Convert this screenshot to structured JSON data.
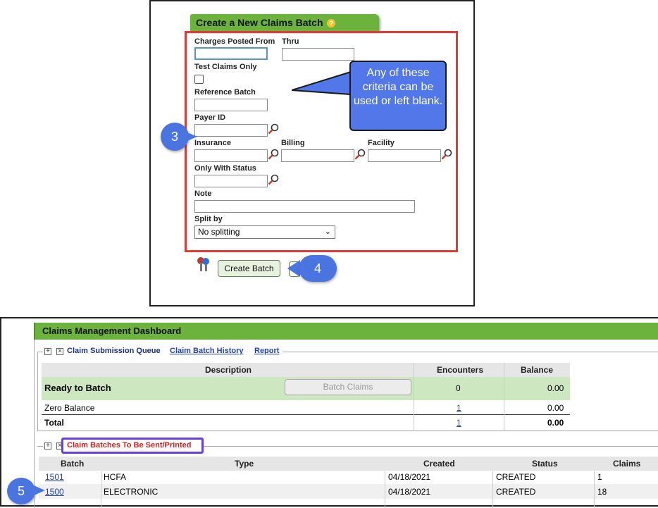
{
  "create_batch": {
    "title": "Create a New Claims Batch",
    "help_icon": "help-icon",
    "fields": {
      "charges_posted_from": {
        "label": "Charges Posted From",
        "value": ""
      },
      "thru": {
        "label": "Thru",
        "value": ""
      },
      "test_claims_only": {
        "label": "Test Claims Only",
        "checked": false
      },
      "reference_batch": {
        "label": "Reference Batch",
        "value": ""
      },
      "payer_id": {
        "label": "Payer ID",
        "value": ""
      },
      "insurance": {
        "label": "Insurance",
        "value": ""
      },
      "billing": {
        "label": "Billing",
        "value": ""
      },
      "facility": {
        "label": "Facility",
        "value": ""
      },
      "only_with_status": {
        "label": "Only With Status",
        "value": ""
      },
      "note": {
        "label": "Note",
        "value": ""
      },
      "split_by": {
        "label": "Split by",
        "selected": "No splitting"
      }
    },
    "create_button": "Create Batch",
    "callout_text": "Any of these criteria can be used or left blank.",
    "step_badges": {
      "payer": "3",
      "create": "4"
    }
  },
  "dashboard": {
    "title": "Claims Management Dashboard",
    "queue": {
      "title": "Claim Submission Queue",
      "links": {
        "history": "Claim Batch History",
        "report": "Report"
      },
      "headers": {
        "description": "Description",
        "encounters": "Encounters",
        "balance": "Balance"
      },
      "batch_claims_button": "Batch Claims",
      "rows": [
        {
          "description": "Ready to Batch",
          "encounters": "0",
          "balance": "0.00"
        },
        {
          "description": "Zero Balance",
          "encounters": "1",
          "balance": "0.00"
        },
        {
          "description": "Total",
          "encounters": "1",
          "balance": "0.00"
        }
      ]
    },
    "batches": {
      "title": "Claim Batches To Be Sent/Printed",
      "headers": {
        "batch": "Batch",
        "type": "Type",
        "created": "Created",
        "status": "Status",
        "claims": "Claims"
      },
      "rows": [
        {
          "batch": "1501",
          "type": "HCFA",
          "created": "04/18/2021",
          "status": "CREATED",
          "claims": "1"
        },
        {
          "batch": "1500",
          "type": "ELECTRONIC",
          "created": "04/18/2021",
          "status": "CREATED",
          "claims": "18"
        }
      ]
    },
    "step_badge": "5"
  },
  "colors": {
    "header_green": "#6cb33e",
    "ready_row": "#cde8c1",
    "callout_blue": "#5177e8",
    "highlight_red": "#e53935",
    "highlight_purple": "#6a3fe0"
  }
}
